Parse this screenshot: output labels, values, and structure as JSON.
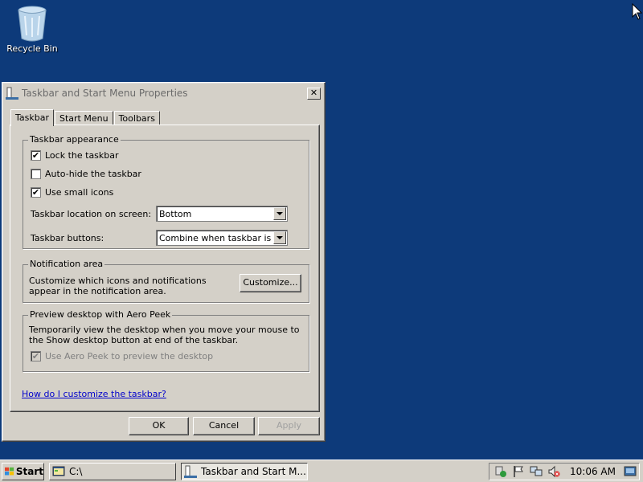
{
  "desktop": {
    "recycle_bin_label": "Recycle Bin"
  },
  "window": {
    "title": "Taskbar and Start Menu Properties",
    "close_label": "✕",
    "tabs": [
      {
        "label": "Taskbar"
      },
      {
        "label": "Start Menu"
      },
      {
        "label": "Toolbars"
      }
    ]
  },
  "appearance": {
    "title": "Taskbar appearance",
    "lock": {
      "label": "Lock the taskbar",
      "checked": true
    },
    "autohide": {
      "label": "Auto-hide the taskbar",
      "checked": false
    },
    "small_icons": {
      "label": "Use small icons",
      "checked": true
    },
    "location_label": "Taskbar location on screen:",
    "location_value": "Bottom",
    "buttons_label": "Taskbar buttons:",
    "buttons_value": "Combine when taskbar is full"
  },
  "notification": {
    "title": "Notification area",
    "text": "Customize which icons and notifications appear in the notification area.",
    "customize_label": "Customize..."
  },
  "aero_peek": {
    "title": "Preview desktop with Aero Peek",
    "text": "Temporarily view the desktop when you move your mouse to the Show desktop button at end of the taskbar.",
    "checkbox_label": "Use Aero Peek to preview the desktop",
    "checked": true
  },
  "help_link": "How do I customize the taskbar?",
  "buttons": {
    "ok": "OK",
    "cancel": "Cancel",
    "apply": "Apply"
  },
  "taskbar": {
    "start_label": "Start",
    "items": [
      {
        "label": "C:\\"
      },
      {
        "label": "Taskbar and Start M..."
      }
    ],
    "clock": "10:06 AM"
  },
  "check_mark": "✔"
}
